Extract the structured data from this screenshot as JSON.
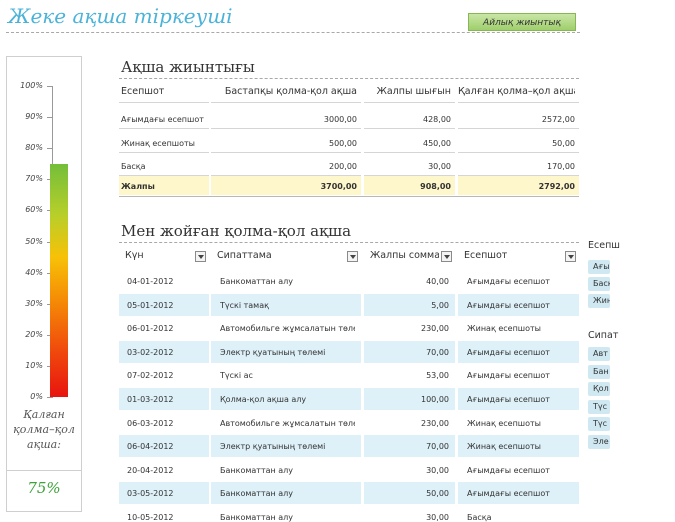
{
  "app": {
    "title": "Жеке ақша тіркеуші",
    "monthly_button": "Айлық жиынтық"
  },
  "gauge": {
    "ticks": [
      "100%",
      "90%",
      "80%",
      "70%",
      "60%",
      "50%",
      "40%",
      "30%",
      "20%",
      "10%",
      "0%"
    ],
    "level": 0.75,
    "caption_lines": [
      "Қалған",
      "қолма–қол",
      "ақша:"
    ],
    "percent_text": "75%"
  },
  "summary": {
    "title": "Ақша жиынтығы",
    "headers": [
      "Есепшот",
      "Бастапқы қолма-қол ақша",
      "Жалпы шығын",
      "Қалған қолма–қол ақша"
    ],
    "rows": [
      [
        "Ағымдағы есепшот",
        "3000,00",
        "428,00",
        "2572,00"
      ],
      [
        "Жинақ есепшоты",
        "500,00",
        "450,00",
        "50,00"
      ],
      [
        "Басқа",
        "200,00",
        "30,00",
        "170,00"
      ]
    ],
    "total": [
      "Жалпы",
      "3700,00",
      "908,00",
      "2792,00"
    ]
  },
  "spent": {
    "title": "Мен жойған қолма-қол ақша",
    "headers": [
      "Күн",
      "Сипаттама",
      "Жалпы сомма",
      "Есепшот"
    ],
    "rows": [
      [
        "04-01-2012",
        "Банкоматтан алу",
        "40,00",
        "Ағымдағы есепшот"
      ],
      [
        "05-01-2012",
        "Түскі тамақ",
        "5,00",
        "Ағымдағы есепшот"
      ],
      [
        "06-01-2012",
        "Автомобильге жұмсалатын төлем",
        "230,00",
        "Жинақ есепшоты"
      ],
      [
        "03-02-2012",
        "Электр қуатының төлемі",
        "70,00",
        "Ағымдағы есепшот"
      ],
      [
        "07-02-2012",
        "Түскі ас",
        "53,00",
        "Ағымдағы есепшот"
      ],
      [
        "01-03-2012",
        "Қолма-қол ақша алу",
        "100,00",
        "Ағымдағы есепшот"
      ],
      [
        "06-03-2012",
        "Автомобильге жұмсалатын төлем",
        "230,00",
        "Жинақ есепшоты"
      ],
      [
        "06-04-2012",
        "Электр қуатының төлемі",
        "70,00",
        "Жинақ есепшоты"
      ],
      [
        "20-04-2012",
        "Банкоматтан алу",
        "30,00",
        "Ағымдағы есепшот"
      ],
      [
        "03-05-2012",
        "Банкоматтан алу",
        "50,00",
        "Ағымдағы есепшот"
      ],
      [
        "10-05-2012",
        "Банкоматтан алу",
        "30,00",
        "Басқа"
      ]
    ]
  },
  "filters": {
    "account_head": "Есепш",
    "account_items": [
      "Ағым",
      "Басқ",
      "Жин"
    ],
    "desc_head": "Сипат",
    "desc_items": [
      "Авт",
      "Бан",
      "Қол",
      "Түс",
      "Түс",
      "Эле"
    ]
  }
}
